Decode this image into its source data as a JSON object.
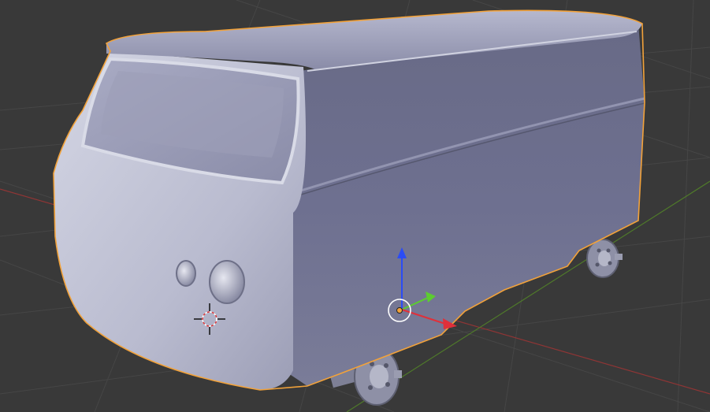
{
  "viewport": {
    "background": "#393939",
    "grid_color": "#4a4a4a",
    "x_axis_color": "#9a3a3a",
    "y_axis_color": "#5f8f2f"
  },
  "model": {
    "name_icon": "van-mesh",
    "body_color": "#7f81a0",
    "selection_outline_color": "#f2a23a"
  },
  "gizmo": {
    "icon": "transform-manipulator-icon",
    "x_color": "#e0303a",
    "y_color": "#5ccc30",
    "z_color": "#2b4cf5",
    "origin_color": "#f2a23a"
  },
  "cursor": {
    "icon": "3d-cursor-icon"
  }
}
